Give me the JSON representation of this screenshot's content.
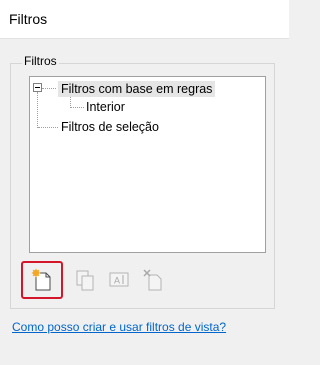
{
  "window": {
    "title": "Filtros"
  },
  "group": {
    "label": "Filtros"
  },
  "tree": {
    "nodes": [
      {
        "label": "Filtros com base em regras",
        "expanded": true,
        "selected": true
      },
      {
        "label": "Interior"
      },
      {
        "label": "Filtros de seleção"
      }
    ]
  },
  "toolbar": {
    "buttons": [
      {
        "icon": "new-filter-icon",
        "state": "enabled",
        "highlighted": true
      },
      {
        "icon": "duplicate-icon",
        "state": "disabled"
      },
      {
        "icon": "rename-icon",
        "state": "disabled"
      },
      {
        "icon": "delete-icon",
        "state": "disabled"
      }
    ],
    "highlight_color": "#d5162a"
  },
  "help": {
    "link_text": "Como posso criar e usar filtros de vista?",
    "link_color": "#0066cc"
  }
}
